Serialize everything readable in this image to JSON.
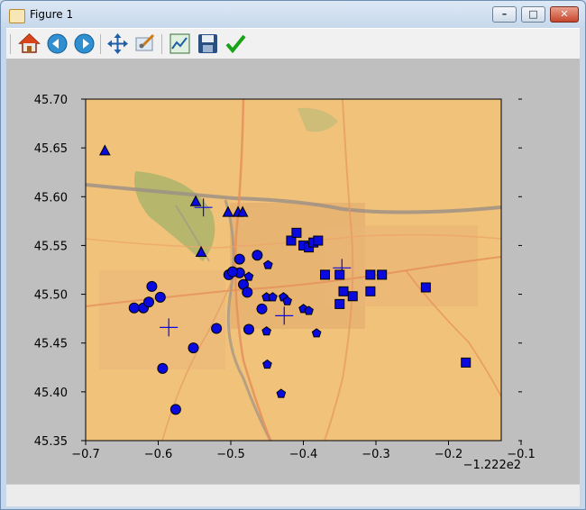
{
  "window": {
    "title": "Figure 1"
  },
  "toolbar": {
    "buttons": [
      {
        "name": "home-icon"
      },
      {
        "name": "back-icon"
      },
      {
        "name": "forward-icon"
      },
      {
        "name": "pan-icon"
      },
      {
        "name": "zoom-icon"
      },
      {
        "name": "subplots-icon"
      },
      {
        "name": "save-icon"
      },
      {
        "name": "edit-axes-icon"
      }
    ]
  },
  "colors": {
    "marker_fill": "#0a0ae0",
    "marker_edge": "#000000",
    "map_base": "#f1c27a",
    "figure_bg": "#bfbfbf"
  },
  "chart_data": {
    "type": "scatter",
    "xlim": [
      -0.67,
      -0.13
    ],
    "ylim": [
      45.35,
      45.7
    ],
    "xticks": [
      -0.7,
      -0.6,
      -0.5,
      -0.4,
      -0.3,
      -0.2,
      -0.1
    ],
    "xtick_labels": [
      "−0.7",
      "−0.6",
      "−0.5",
      "−0.4",
      "−0.3",
      "−0.2",
      "−0.1"
    ],
    "yticks": [
      45.35,
      45.4,
      45.45,
      45.5,
      45.55,
      45.6,
      45.65,
      45.7
    ],
    "ytick_labels": [
      "45.35",
      "45.40",
      "45.45",
      "45.50",
      "45.55",
      "45.60",
      "45.65",
      "45.70"
    ],
    "x_offset_label": "−1.222e2",
    "background": "street map",
    "series": [
      {
        "marker": "triangle",
        "points": [
          [
            -0.645,
            45.647
          ],
          [
            -0.527,
            45.595
          ],
          [
            -0.485,
            45.584
          ],
          [
            -0.472,
            45.584
          ],
          [
            -0.466,
            45.584
          ],
          [
            -0.52,
            45.543
          ]
        ]
      },
      {
        "marker": "plus",
        "points": [
          [
            -0.517,
            45.589
          ],
          [
            -0.562,
            45.466
          ],
          [
            -0.412,
            45.478
          ],
          [
            -0.337,
            45.527
          ]
        ]
      },
      {
        "marker": "circle",
        "points": [
          [
            -0.607,
            45.486
          ],
          [
            -0.595,
            45.486
          ],
          [
            -0.588,
            45.492
          ],
          [
            -0.584,
            45.508
          ],
          [
            -0.573,
            45.497
          ],
          [
            -0.57,
            45.424
          ],
          [
            -0.553,
            45.382
          ],
          [
            -0.53,
            45.445
          ],
          [
            -0.5,
            45.465
          ],
          [
            -0.47,
            45.536
          ],
          [
            -0.47,
            45.522
          ],
          [
            -0.465,
            45.51
          ],
          [
            -0.46,
            45.502
          ],
          [
            -0.458,
            45.464
          ],
          [
            -0.447,
            45.54
          ],
          [
            -0.441,
            45.485
          ],
          [
            -0.484,
            45.52
          ],
          [
            -0.479,
            45.523
          ]
        ]
      },
      {
        "marker": "pentagon",
        "points": [
          [
            -0.458,
            45.518
          ],
          [
            -0.433,
            45.53
          ],
          [
            -0.435,
            45.497
          ],
          [
            -0.427,
            45.497
          ],
          [
            -0.413,
            45.497
          ],
          [
            -0.408,
            45.493
          ],
          [
            -0.387,
            45.485
          ],
          [
            -0.38,
            45.483
          ],
          [
            -0.37,
            45.46
          ],
          [
            -0.434,
            45.428
          ],
          [
            -0.435,
            45.462
          ],
          [
            -0.416,
            45.398
          ]
        ]
      },
      {
        "marker": "square",
        "points": [
          [
            -0.403,
            45.555
          ],
          [
            -0.396,
            45.563
          ],
          [
            -0.387,
            45.55
          ],
          [
            -0.38,
            45.548
          ],
          [
            -0.374,
            45.553
          ],
          [
            -0.368,
            45.555
          ],
          [
            -0.359,
            45.52
          ],
          [
            -0.34,
            45.52
          ],
          [
            -0.34,
            45.49
          ],
          [
            -0.335,
            45.503
          ],
          [
            -0.323,
            45.498
          ],
          [
            -0.3,
            45.52
          ],
          [
            -0.3,
            45.503
          ],
          [
            -0.285,
            45.52
          ],
          [
            -0.228,
            45.507
          ],
          [
            -0.176,
            45.43
          ]
        ]
      }
    ]
  }
}
